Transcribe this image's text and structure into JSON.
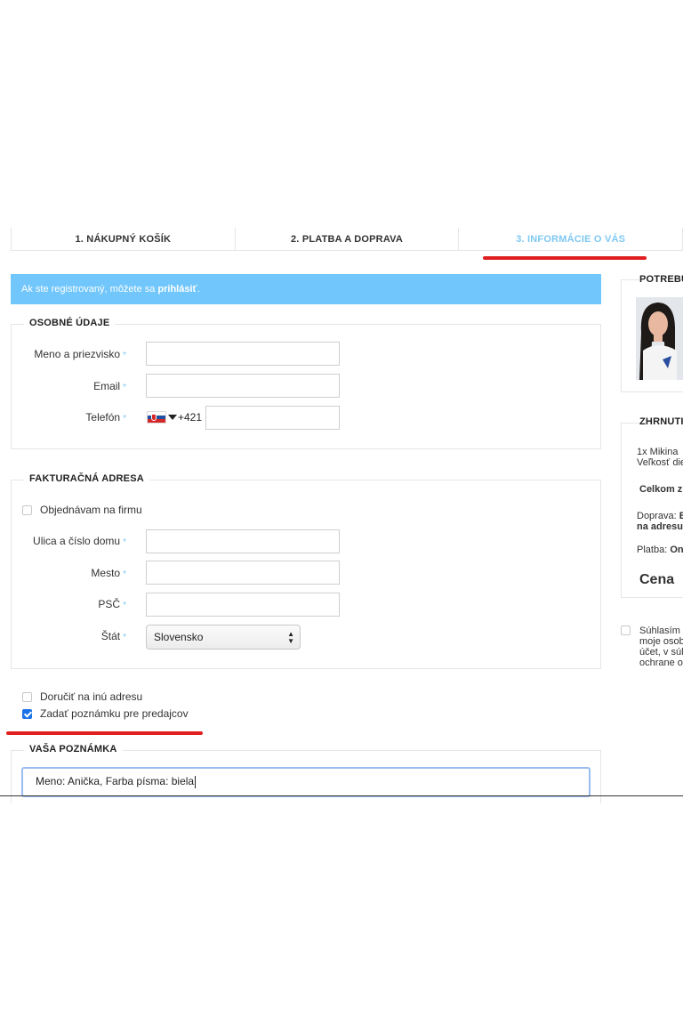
{
  "steps": [
    {
      "label": "1. NÁKUPNÝ KOŠÍK",
      "active": false
    },
    {
      "label": "2. PLATBA A DOPRAVA",
      "active": false
    },
    {
      "label": "3. INFORMÁCIE O VÁS",
      "active": true
    }
  ],
  "banner": {
    "text": "Ak ste registrovaný, môžete sa",
    "link": "prihlásiť",
    "suffix": "."
  },
  "personal": {
    "title": "OSOBNÉ ÚDAJE",
    "name_label": "Meno a priezvisko",
    "email_label": "Email",
    "phone_label": "Telefón",
    "phone_prefix": "+421",
    "required_mark": "*"
  },
  "billing": {
    "title": "FAKTURAČNÁ ADRESA",
    "company_label": "Objednávam na firmu",
    "street_label": "Ulica a číslo domu",
    "city_label": "Mesto",
    "zip_label": "PSČ",
    "country_label": "Štát",
    "country_value": "Slovensko"
  },
  "options": {
    "other_address_label": "Doručiť na inú adresu",
    "note_label": "Zadať poznámku pre predajcov",
    "note_checked": true
  },
  "note": {
    "title": "VAŠA POZNÁMKA",
    "value": "Meno: Anička, Farba písma: biela"
  },
  "sidebar": {
    "help_title": "POTREBU",
    "summary_title": "ZHRNUTI",
    "item_line1": "1x Mikina",
    "item_line2": "Veľkosť die",
    "total_label": "Celkom z",
    "shipping_label": "Doprava:",
    "shipping_value1": "E",
    "shipping_value2": "na adresu",
    "payment_label": "Platba:",
    "payment_value": "On",
    "price_label": "Cena",
    "consent_line1": "Súhlasím",
    "consent_line2": "moje osob",
    "consent_line3": "účet, v súl",
    "consent_line4": "ochrane o"
  },
  "colors": {
    "accent": "#71c6fb",
    "active_step": "#7ec8f3",
    "annotation": "#e02020",
    "checkbox": "#1a73e8"
  }
}
